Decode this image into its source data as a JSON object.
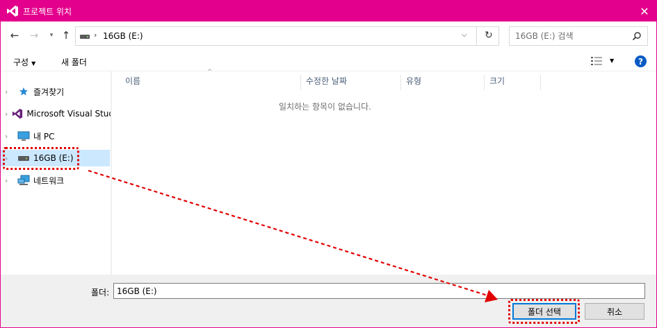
{
  "window": {
    "title": "프로젝트 위치",
    "accent_color": "#e3008c",
    "app_icon": "visual-studio-icon",
    "close_icon": "close-icon"
  },
  "navigation": {
    "back_icon": "back-arrow-icon",
    "forward_icon": "forward-arrow-icon",
    "recent_icon": "chevron-down-icon",
    "up_icon": "up-arrow-icon",
    "address_path": "16GB (E:)",
    "search_placeholder": "16GB (E:) 검색"
  },
  "toolbar": {
    "organize_label": "구성",
    "new_folder_label": "새 폴더"
  },
  "sidebar": {
    "items": [
      {
        "label": "즐겨찾기",
        "icon": "star-icon"
      },
      {
        "label": "Microsoft Visual Studio",
        "icon": "visual-studio-icon"
      },
      {
        "label": "내 PC",
        "icon": "computer-icon"
      },
      {
        "label": "16GB (E:)",
        "icon": "drive-icon",
        "selected": true
      },
      {
        "label": "네트워크",
        "icon": "network-icon"
      }
    ]
  },
  "content": {
    "columns": [
      "이름",
      "수정한 날짜",
      "유형",
      "크기"
    ],
    "empty_message": "일치하는 항목이 없습니다."
  },
  "bottom": {
    "folder_label": "폴더:",
    "folder_value": "16GB (E:)",
    "select_button": "폴더 선택",
    "cancel_button": "취소"
  },
  "annotation": {
    "color": "#e10000"
  }
}
